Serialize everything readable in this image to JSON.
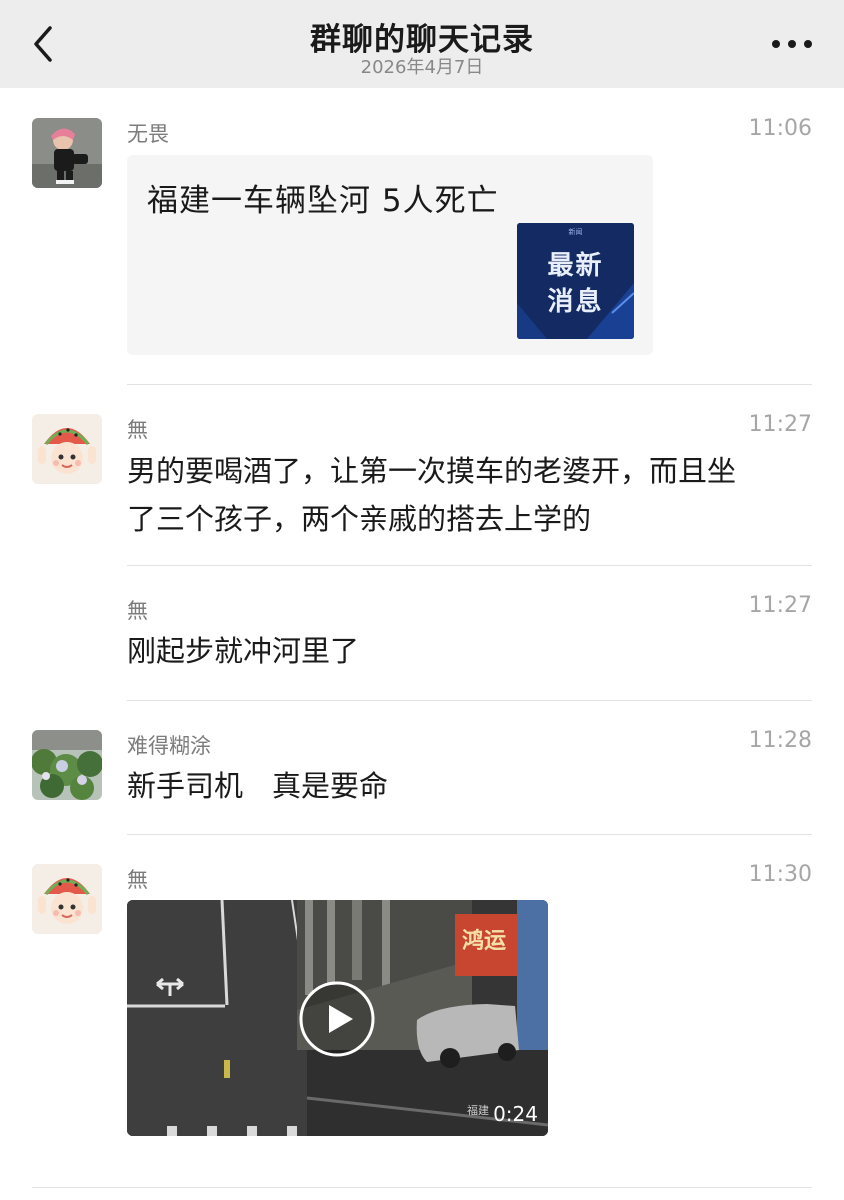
{
  "header": {
    "title": "群聊的聊天记录",
    "date": "2026年4月7日",
    "back_icon": "chevron-left-icon",
    "more_icon": "more-dots-icon"
  },
  "messages": [
    {
      "sender": "无畏",
      "time": "11:06",
      "type": "link_card",
      "card": {
        "title": "福建一车辆坠河 5人死亡",
        "thumb_line1": "最新",
        "thumb_line2": "消息",
        "thumb_tag": "新闻"
      }
    },
    {
      "sender": "無",
      "time": "11:27",
      "type": "text",
      "lines": [
        "男的要喝酒了，让第一次摸车的老婆开，而且坐",
        "了三个孩子，两个亲戚的搭去上学的"
      ]
    },
    {
      "sender": "無",
      "time": "11:27",
      "type": "text",
      "lines": [
        "刚起步就冲河里了"
      ]
    },
    {
      "sender": "难得糊涂",
      "time": "11:28",
      "type": "text",
      "lines": [
        "新手司机　真是要命"
      ]
    },
    {
      "sender": "無",
      "time": "11:30",
      "type": "video",
      "video": {
        "duration": "0:24",
        "sign_text": "鸿运",
        "watermark": "福建"
      }
    }
  ],
  "colors": {
    "nav_bg": "#ededed",
    "card_bg": "#f5f5f5",
    "sender": "#7c7c7c",
    "time": "#a6a6a6"
  }
}
